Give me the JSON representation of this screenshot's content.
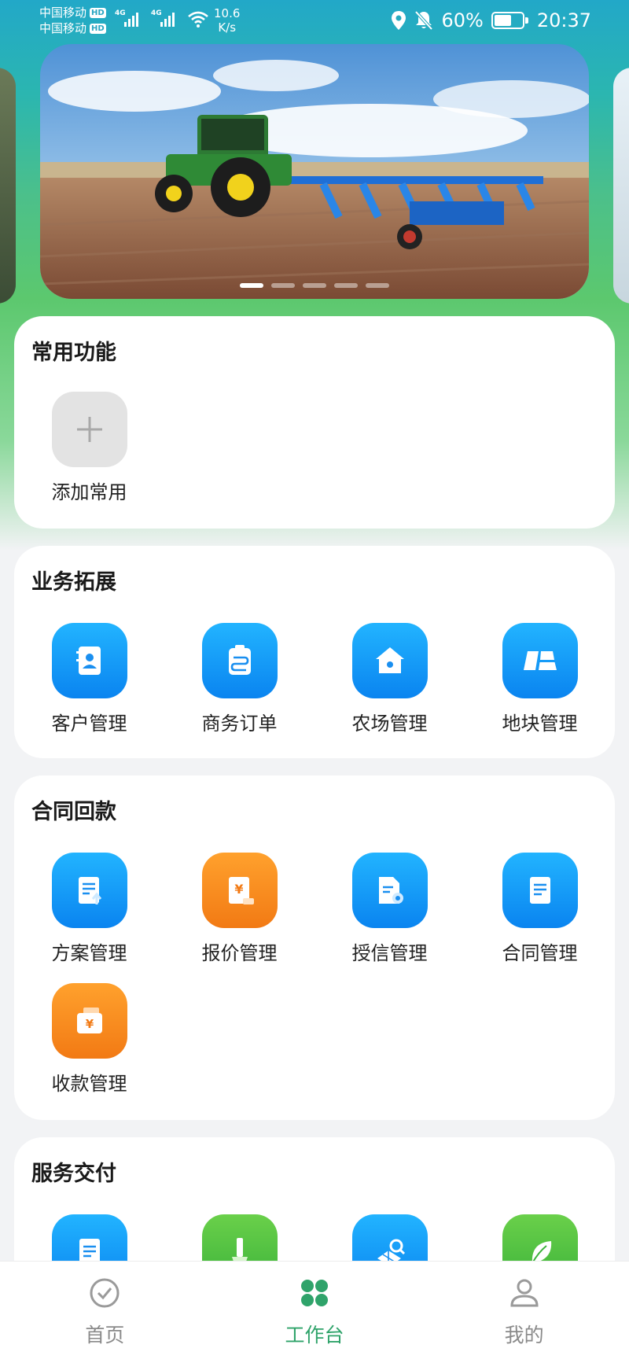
{
  "status_bar": {
    "carrier_1": "中国移动",
    "carrier_2": "中国移动",
    "hd": "HD",
    "lte": "4G",
    "speed_value": "10.6",
    "speed_unit": "K/s",
    "battery": "60%",
    "time": "20:37"
  },
  "banner": {
    "dots_total": 5,
    "active_dot": 0
  },
  "common": {
    "title": "常用功能",
    "add_label": "添加常用"
  },
  "business": {
    "title": "业务拓展",
    "items": [
      {
        "label": "客户管理",
        "icon": "contacts-icon"
      },
      {
        "label": "商务订单",
        "icon": "order-icon"
      },
      {
        "label": "农场管理",
        "icon": "farm-house-icon"
      },
      {
        "label": "地块管理",
        "icon": "land-plot-icon"
      }
    ]
  },
  "contract": {
    "title": "合同回款",
    "items": [
      {
        "label": "方案管理",
        "icon": "plan-doc-icon"
      },
      {
        "label": "报价管理",
        "icon": "quote-icon"
      },
      {
        "label": "授信管理",
        "icon": "credit-doc-icon"
      },
      {
        "label": "合同管理",
        "icon": "contract-doc-icon"
      },
      {
        "label": "收款管理",
        "icon": "wallet-icon"
      }
    ]
  },
  "service": {
    "title": "服务交付",
    "items": [
      {
        "label": "",
        "icon": "service-doc-icon"
      },
      {
        "label": "",
        "icon": "tool-icon"
      },
      {
        "label": "",
        "icon": "solar-search-icon"
      },
      {
        "label": "",
        "icon": "leaf-icon"
      }
    ]
  },
  "nav": {
    "home": "首页",
    "workbench": "工作台",
    "mine": "我的"
  },
  "colors": {
    "accent_green": "#2fa36a",
    "icon_blue": "#0a84f0",
    "icon_orange": "#f27a14",
    "icon_green": "#3bb23a"
  }
}
